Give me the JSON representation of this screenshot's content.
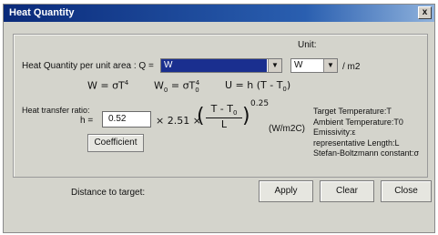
{
  "window": {
    "title": "Heat Quantity",
    "close_glyph": "x"
  },
  "unit_label": "Unit:",
  "heat_quantity_label": "Heat Quantity per unit area : Q =",
  "quantity_select": {
    "value": "W"
  },
  "unit_select": {
    "value": "W"
  },
  "unit_suffix": "/ m2",
  "formulas": {
    "f1": "W = σT",
    "f1_sup": "4",
    "f2": "W",
    "f2_sub": "0",
    "f2_mid": " = σT",
    "f2_sup": "4",
    "f2_sub2": "0",
    "f3": "U = h (T - T",
    "f3_sub": "0",
    "f3_end": ")"
  },
  "heat_transfer": {
    "label": "Heat transfer ratio:",
    "h_label": "h =",
    "h_value": "0.52",
    "coef_text": "× 2.51 ×",
    "numerator": "T - T",
    "numerator_sub": "0",
    "denominator": "L",
    "exponent": "0.25",
    "unit": "(W/m2C)"
  },
  "legend": [
    "Target Temperature:T",
    "Ambient Temperature:T0",
    "Emissivity:ε",
    "representative Length:L",
    "Stefan-Boltzmann constant:σ"
  ],
  "buttons": {
    "coefficient": "Coefficient",
    "apply": "Apply",
    "clear": "Clear",
    "close": "Close"
  },
  "distance_label": "Distance to target:"
}
